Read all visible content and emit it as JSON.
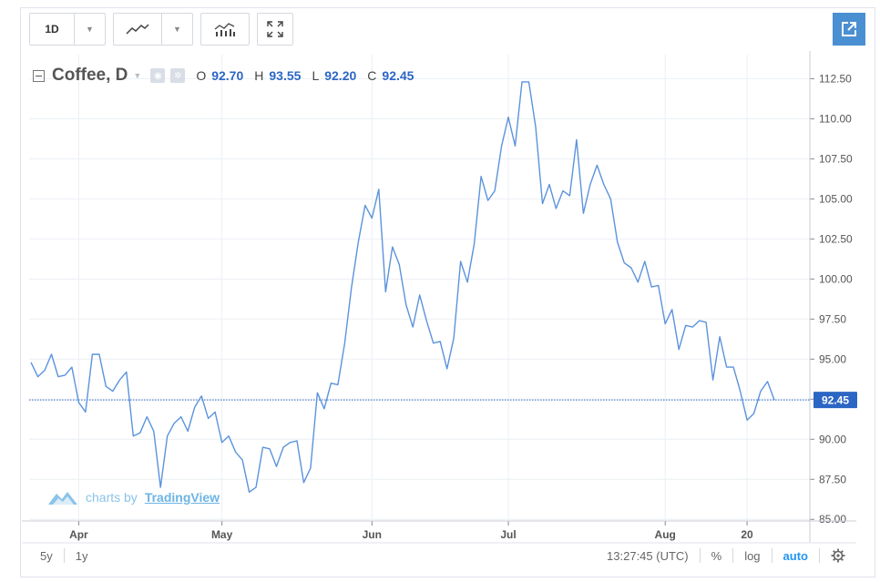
{
  "toolbar": {
    "interval": "1D"
  },
  "legend": {
    "symbol": "Coffee, D",
    "o_label": "O",
    "o_value": "92.70",
    "h_label": "H",
    "h_value": "93.55",
    "l_label": "L",
    "l_value": "92.20",
    "c_label": "C",
    "c_value": "92.45"
  },
  "watermark": {
    "prefix": "charts by",
    "brand": "TradingView"
  },
  "bottom_bar": {
    "range_5y": "5y",
    "range_1y": "1y",
    "time": "13:27:45 (UTC)",
    "percent": "%",
    "log": "log",
    "auto": "auto"
  },
  "colors": {
    "line": "#5b93dc",
    "price_line": "#2c66c4",
    "grid": "#eceff4",
    "accent": "#4a8fd1"
  },
  "chart_data": {
    "type": "line",
    "series": [
      {
        "values": [
          94.8,
          93.9,
          94.3,
          95.3,
          93.9,
          94.0,
          94.5,
          92.3,
          91.7,
          95.3,
          95.3,
          93.3,
          93.0,
          93.7,
          94.2,
          90.2,
          90.4,
          91.4,
          90.5,
          87.0,
          90.2,
          91.0,
          91.4,
          90.5,
          92.0,
          92.7,
          91.3,
          91.7,
          89.8,
          90.2,
          89.2,
          88.7,
          86.7,
          87.0,
          89.5,
          89.4,
          88.3,
          89.5,
          89.8,
          89.9,
          87.3,
          88.2,
          92.9,
          91.9,
          93.5,
          93.4,
          96.0,
          99.5,
          102.3,
          104.6,
          103.8,
          105.6,
          99.2,
          102.0,
          100.9,
          98.4,
          97.0,
          99.0,
          97.4,
          96.0,
          96.1,
          94.4,
          96.3,
          101.1,
          99.8,
          102.2,
          106.4,
          104.9,
          105.5,
          108.3,
          110.1,
          108.3,
          112.3,
          112.3,
          109.5,
          104.7,
          105.9,
          104.4,
          105.5,
          105.2,
          108.7,
          104.1,
          105.9,
          107.1,
          105.9,
          105.0,
          102.3,
          101.0,
          100.7,
          99.8,
          101.1,
          99.5,
          99.6,
          97.2,
          98.1,
          95.6,
          97.1,
          97.0,
          97.4,
          97.3,
          93.7,
          96.4,
          94.5,
          94.5,
          93.0,
          91.2,
          91.6,
          93.0,
          93.6,
          92.45
        ]
      }
    ],
    "x_ticks": [
      "Apr",
      "May",
      "Jun",
      "Jul",
      "Aug",
      "20"
    ],
    "x_tick_index": [
      7,
      28,
      50,
      70,
      93,
      105
    ],
    "y_ticks": [
      85.0,
      87.5,
      90.0,
      92.5,
      95.0,
      97.5,
      100.0,
      102.5,
      105.0,
      107.5,
      110.0,
      112.5
    ],
    "ylim": [
      84.9,
      114.0
    ],
    "last_price": 92.45,
    "last_price_label": "92.45",
    "grid": true
  }
}
